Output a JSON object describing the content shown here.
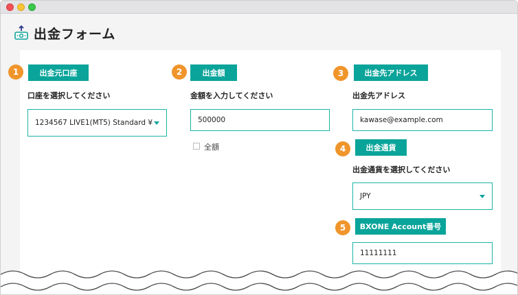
{
  "page": {
    "title": "出金フォーム",
    "icon": "money-withdraw-icon"
  },
  "sections": {
    "source_account": {
      "number": "1",
      "tag": "出金元口座",
      "label": "口座を選択してください",
      "selected": "1234567 LIVE1(MT5) Standard ¥5..."
    },
    "amount": {
      "number": "2",
      "tag": "出金額",
      "label": "金額を入力してください",
      "value": "500000",
      "full_amount_label": "全額"
    },
    "destination_address": {
      "number": "3",
      "tag": "出金先アドレス",
      "label": "出金先アドレス",
      "value": "kawase@example.com"
    },
    "currency": {
      "number": "4",
      "tag": "出金通貨",
      "label": "出金通貨を選択してください",
      "selected": "JPY"
    },
    "bxone_account": {
      "number": "5",
      "tag": "BXONE Account番号",
      "value": "11111111"
    }
  },
  "colors": {
    "accent": "#0aa49a",
    "badge": "#f0952b",
    "border": "#1ab3a6"
  }
}
